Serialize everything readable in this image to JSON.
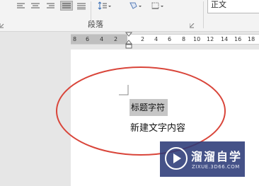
{
  "ribbon": {
    "paragraph_group_label": "段落",
    "style_sample": "正文",
    "icons": [
      "align-left-icon",
      "align-center-icon",
      "align-right-icon",
      "justify-icon",
      "distributed-icon",
      "line-spacing-icon",
      "shading-icon",
      "borders-icon"
    ]
  },
  "ruler": {
    "ticks": [
      "8",
      "6",
      "4",
      "2",
      "2",
      "4",
      "6",
      "8",
      "10",
      "12",
      "14",
      "16",
      "18"
    ]
  },
  "document": {
    "heading_text": "标题字符",
    "body_text": "新建文字内容"
  },
  "annotation": {
    "color": "#d9453a"
  },
  "watermark": {
    "title": "溜溜自学",
    "url": "ZIXUE.3D66.COM"
  }
}
